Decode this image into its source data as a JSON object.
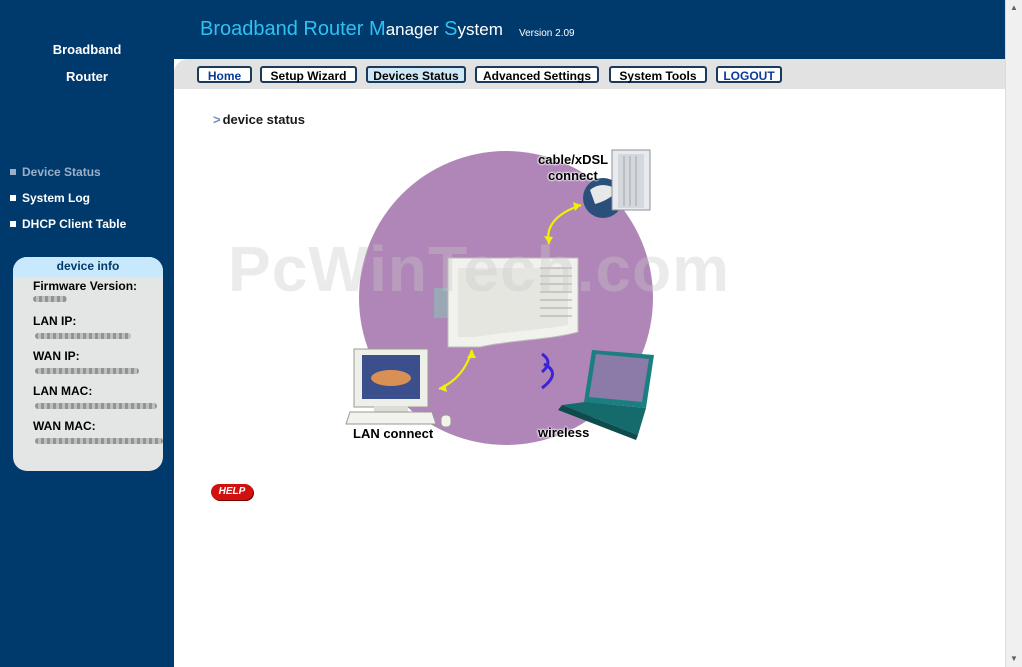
{
  "sidebar": {
    "brand_line1": "Broadband",
    "brand_line2": "Router",
    "items": [
      {
        "label": "Device Status",
        "active": true
      },
      {
        "label": "System Log",
        "active": false
      },
      {
        "label": "DHCP Client Table",
        "active": false
      }
    ],
    "info": {
      "title": "device info",
      "firmware_label": "Firmware Version:",
      "lan_ip_label": "LAN IP:",
      "wan_ip_label": "WAN IP:",
      "lan_mac_label": "LAN MAC:",
      "wan_mac_label": "WAN MAC:"
    }
  },
  "header": {
    "title_b": "B",
    "title_roadband": "roadband",
    "title_r": " R",
    "title_outer": "outer",
    "title_m": " M",
    "title_anager": "anager",
    "title_s": " S",
    "title_ystem": "ystem",
    "version": "Version 2.09"
  },
  "nav": {
    "home": "Home",
    "setup_wizard": "Setup Wizard",
    "devices_status": "Devices Status",
    "advanced_settings": "Advanced Settings",
    "system_tools": "System Tools",
    "logout": "LOGOUT"
  },
  "main": {
    "section_title": "device status",
    "diagram": {
      "cable_line1": "cable/xDSL",
      "cable_line2": "connect",
      "lan_label": "LAN connect",
      "wireless_label": "wireless"
    },
    "watermark": "PcWinTech.com",
    "help_label": "HELP"
  },
  "colors": {
    "sidebar_bg": "#003a6d",
    "title_accent": "#2ec2f0",
    "circle": "#b086b8",
    "arrow": "#f0f000"
  }
}
